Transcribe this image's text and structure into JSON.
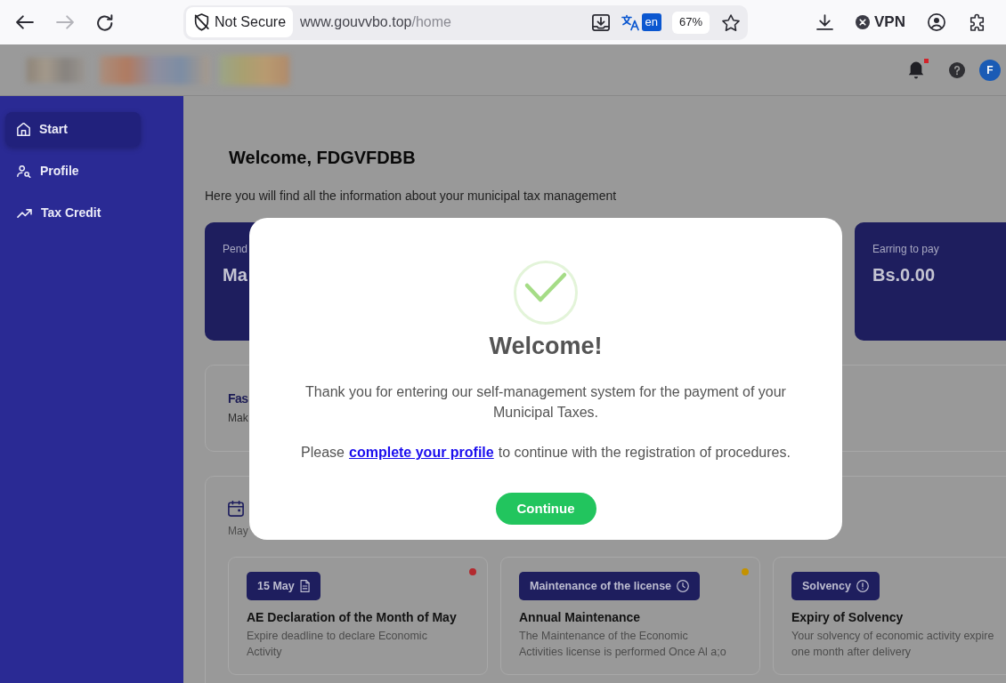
{
  "browser": {
    "nav_buttons": [
      {
        "kind": "back",
        "disabled": false
      },
      {
        "kind": "forward",
        "disabled": true
      },
      {
        "kind": "reload",
        "disabled": false
      }
    ],
    "security_label": "Not Secure",
    "url": {
      "domain": "www.gouvvbo.top",
      "path": "/home"
    },
    "translate_language": "en",
    "zoom_level": "67%",
    "vpn_label": "VPN"
  },
  "header": {
    "notifications": {
      "unread": true
    },
    "avatar_initial": "F"
  },
  "sidebar": {
    "items": [
      {
        "label": "Start",
        "selected": true
      },
      {
        "label": "Profile",
        "selected": false
      },
      {
        "label": "Tax Credit",
        "selected": false
      }
    ]
  },
  "welcome": {
    "title": "Welcome, FDGVFDBB",
    "subtitle": "Here you will find all the information about your municipal tax management"
  },
  "stat_cards": [
    {
      "label": "Pend",
      "value": "Ma"
    },
    {
      "label": "Earring to pay",
      "value": "Bs.0.00"
    }
  ],
  "quick_access": {
    "title": "Fas",
    "text": "Mak"
  },
  "calendar": {
    "subtitle": "May",
    "events": [
      {
        "tag": "15 May",
        "title": "AE Declaration of the Month of May",
        "description": [
          "Expire deadline to declare Economic",
          "Activity"
        ],
        "color": "#b3292e"
      },
      {
        "tag": "Maintenance of the license",
        "title": "Annual Maintenance",
        "description": [
          "The Maintenance of the Economic",
          "Activities license is performed Once Al a;o"
        ],
        "color": "#c49200"
      },
      {
        "tag": "Solvency",
        "title": "Expiry of Solvency",
        "description": [
          "Your solvency of economic activity expire",
          "one month after delivery"
        ]
      }
    ]
  },
  "modal": {
    "title": "Welcome!",
    "message": "Thank you for entering our self-management system for the payment of your Municipal Taxes.",
    "prompt": {
      "before": "Please",
      "link": "complete your profile",
      "after": "to continue with the registration of procedures."
    },
    "button": "Continue"
  }
}
